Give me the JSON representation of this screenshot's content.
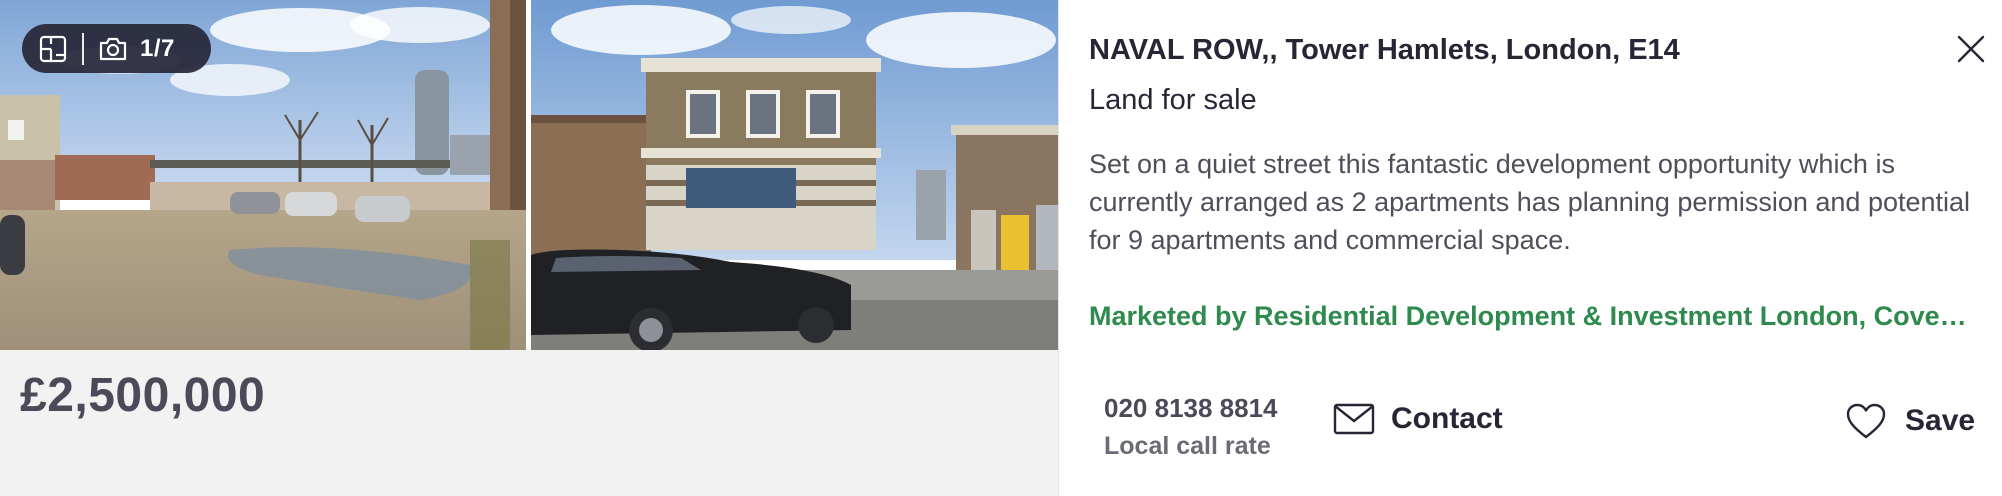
{
  "media": {
    "photo_counter": "1/7",
    "photos": [
      {
        "icon": "yard-photo"
      },
      {
        "icon": "building-photo"
      }
    ],
    "floorplan_icon": "floorplan-icon",
    "camera_icon": "camera-icon"
  },
  "listing": {
    "price": "£2,500,000",
    "address": "NAVAL ROW,, Tower Hamlets, London, E14",
    "type": "Land for sale",
    "description": "Set on a quiet street this fantastic development opportunity which is currently arranged as 2 apartments has planning permission and potential for 9 apartments and commercial space.",
    "marketed_by": "Marketed by Residential Development & Investment London, Covent Garden"
  },
  "actions": {
    "phone_number": "020 8138 8814",
    "phone_rate": "Local call rate",
    "contact_label": "Contact",
    "save_label": "Save",
    "close_icon": "close-icon",
    "contact_icon": "envelope-icon",
    "save_icon": "heart-icon"
  },
  "colors": {
    "marketed_green": "#2f8a4e",
    "badge_bg": "#262637",
    "text_dark": "#262637",
    "price_grey": "#4a4a58",
    "media_bg": "#f2f2f2"
  }
}
